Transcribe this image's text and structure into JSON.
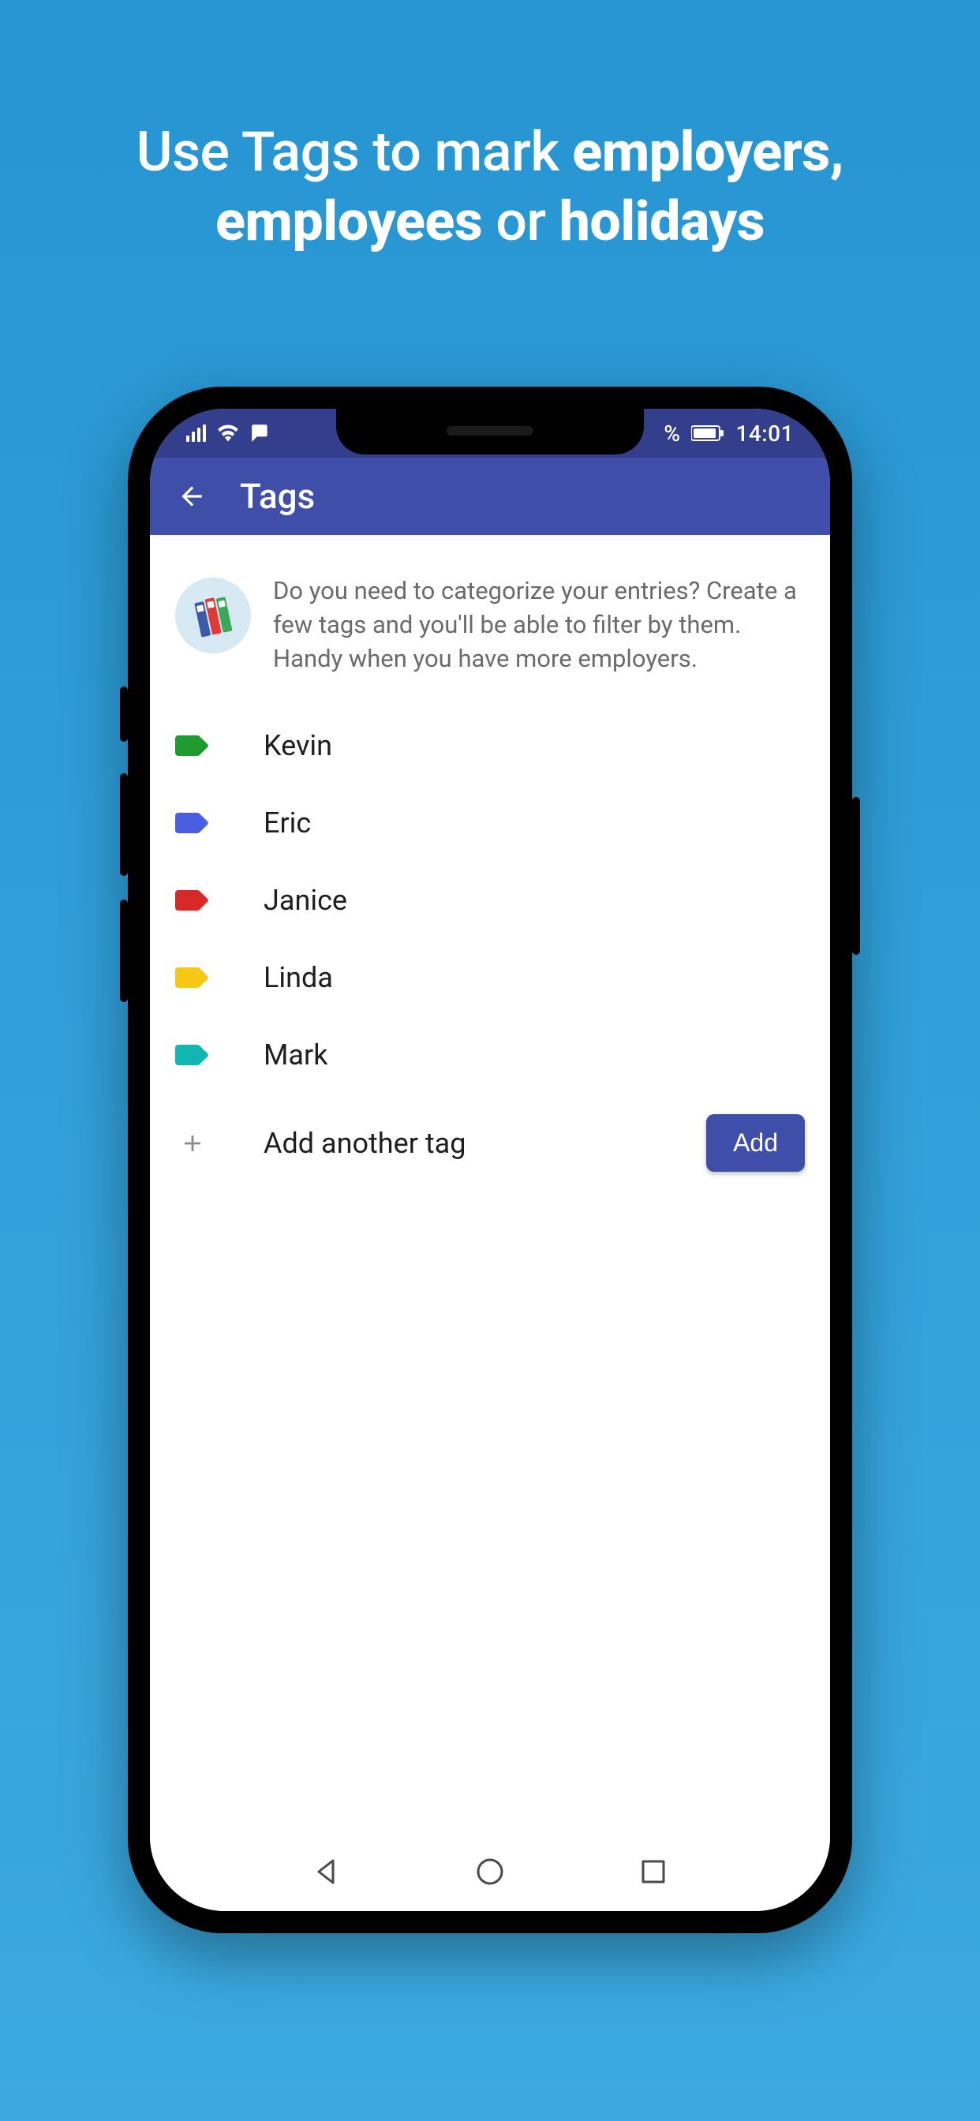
{
  "promo": {
    "prefix": "Use Tags to mark ",
    "bold1": "employers,",
    "mid_bold": "employees",
    "mid_plain": " or ",
    "bold2": "holidays"
  },
  "statusbar": {
    "time": "14:01",
    "battery_pct_fragment": "%"
  },
  "appbar": {
    "title": "Tags"
  },
  "intro": {
    "text": "Do you need to categorize your entries? Create a few tags and you'll be able to filter by them. Handy when you have more employers."
  },
  "tags": [
    {
      "name": "Kevin",
      "color": "#1f9a2e"
    },
    {
      "name": "Eric",
      "color": "#4a5ee0"
    },
    {
      "name": "Janice",
      "color": "#d82828"
    },
    {
      "name": "Linda",
      "color": "#f6c715"
    },
    {
      "name": "Mark",
      "color": "#12b6b0"
    }
  ],
  "add": {
    "label": "Add another tag",
    "button": "Add"
  }
}
